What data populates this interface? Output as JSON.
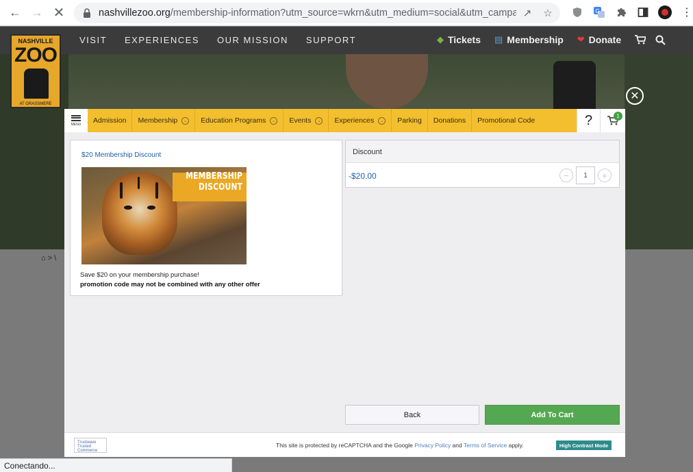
{
  "browser": {
    "url_host": "nashvillezoo.org",
    "url_path": "/membership-information?utm_source=wkrn&utm_medium=social&utm_campa...",
    "status_text": "Conectando..."
  },
  "site": {
    "logo_line1": "NASHVILLE",
    "logo_line2": "ZOO",
    "logo_line3": "AT GRASSMERE",
    "nav": [
      "VISIT",
      "EXPERIENCES",
      "OUR MISSION",
      "SUPPORT"
    ],
    "actions": {
      "tickets": "Tickets",
      "membership": "Membership",
      "donate": "Donate"
    }
  },
  "modal": {
    "menu_label": "MENU",
    "categories": [
      {
        "label": "Admission",
        "has_chevron": false
      },
      {
        "label": "Membership",
        "has_chevron": true
      },
      {
        "label": "Education Programs",
        "has_chevron": true
      },
      {
        "label": "Events",
        "has_chevron": true
      },
      {
        "label": "Experiences",
        "has_chevron": true
      },
      {
        "label": "Parking",
        "has_chevron": false
      },
      {
        "label": "Donations",
        "has_chevron": false
      },
      {
        "label": "Promotional Code",
        "has_chevron": false
      }
    ],
    "help_label": "?",
    "cart_count": "1",
    "promo": {
      "title": "$20 Membership Discount",
      "banner_line1": "MEMBERSHIP",
      "banner_line2": "DISCOUNT",
      "description": "Save $20 on your membership purchase!",
      "note": "promotion code may not be combined with any other offer"
    },
    "discount": {
      "header": "Discount",
      "price": "-$20.00",
      "quantity": "1"
    },
    "buttons": {
      "back": "Back",
      "add_to_cart": "Add To Cart"
    },
    "footer": {
      "trustwave_line1": "Trustwave",
      "trustwave_line2": "Trusted Commerce",
      "recaptcha_prefix": "This site is protected by reCAPTCHA and the Google",
      "privacy": "Privacy Policy",
      "and": "and",
      "terms": "Terms of Service",
      "apply": "apply.",
      "high_contrast": "High Contrast Mode"
    }
  },
  "colors": {
    "category_bar": "#f3bf2f",
    "add_to_cart": "#55a852",
    "link_blue": "#2160a8",
    "high_contrast": "#2e8b8b"
  }
}
